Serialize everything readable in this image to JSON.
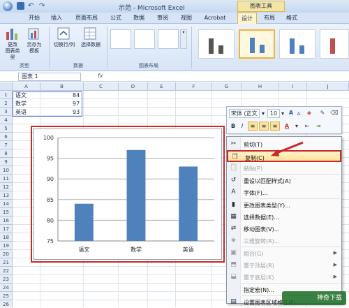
{
  "window": {
    "title": "示范 - Microsoft Excel",
    "context_tab_title": "图表工具"
  },
  "tabs": [
    {
      "label": "开始"
    },
    {
      "label": "插入"
    },
    {
      "label": "页面布局"
    },
    {
      "label": "公式"
    },
    {
      "label": "数据"
    },
    {
      "label": "审阅"
    },
    {
      "label": "视图"
    },
    {
      "label": "Acrobat"
    },
    {
      "label": "设计"
    },
    {
      "label": "布局"
    },
    {
      "label": "格式"
    }
  ],
  "ribbon": {
    "change_type_label": "更改\n图表类型",
    "save_template_label": "另存为\n模板",
    "switch_row_col_label": "切换行/列",
    "select_data_label": "选择数据",
    "group_type": "类型",
    "group_data": "数据",
    "group_layout": "图表布局"
  },
  "formula_bar": {
    "name_box": "图表 1",
    "fx": "fx"
  },
  "sheet": {
    "columns": [
      "A",
      "B",
      "C",
      "D",
      "E",
      "F",
      "G",
      "H",
      "I",
      "J"
    ],
    "rows": [
      "1",
      "2",
      "3",
      "4",
      "5",
      "6",
      "7",
      "8",
      "9",
      "10",
      "11",
      "12",
      "13",
      "14",
      "15",
      "16",
      "17",
      "18",
      "19",
      "20",
      "21",
      "22",
      "23",
      "24",
      "25",
      "26",
      "27"
    ],
    "cells": [
      {
        "a": "语文",
        "b": "84"
      },
      {
        "a": "数学",
        "b": "97"
      },
      {
        "a": "英语",
        "b": "93"
      }
    ]
  },
  "chart_data": {
    "type": "bar",
    "categories": [
      "语文",
      "数学",
      "英语"
    ],
    "values": [
      84,
      97,
      93
    ],
    "ylim": [
      75,
      100
    ],
    "yticks": [
      "75",
      "80",
      "85",
      "90",
      "95",
      "100"
    ],
    "bar_color": "#4f81bd",
    "grid": true
  },
  "mini_toolbar": {
    "font": "宋体 (正文",
    "size": "10",
    "bold": "B",
    "italic": "I"
  },
  "context_menu": [
    {
      "label": "剪切(T)",
      "icon": "scissors-icon",
      "glyph": "✂",
      "disabled": false
    },
    {
      "label": "复制(C)",
      "icon": "copy-icon",
      "glyph": "❐",
      "disabled": false,
      "highlight": true
    },
    {
      "label": "粘贴(P)",
      "icon": "paste-icon",
      "glyph": "📋",
      "disabled": true
    },
    {
      "label": "重设以匹配样式(A)",
      "icon": "reset-style-icon",
      "glyph": "↺",
      "disabled": false
    },
    {
      "label": "字体(F)...",
      "icon": "font-icon",
      "glyph": "A",
      "disabled": false
    },
    {
      "label": "更改图表类型(Y)...",
      "icon": "chart-type-icon",
      "glyph": "▮",
      "disabled": false
    },
    {
      "label": "选择数据(E)...",
      "icon": "select-data-icon",
      "glyph": "▦",
      "disabled": false
    },
    {
      "label": "移动图表(V)...",
      "icon": "move-chart-icon",
      "glyph": "⇄",
      "disabled": false
    },
    {
      "label": "三维旋转(R)...",
      "icon": "rotate-3d-icon",
      "glyph": "◈",
      "disabled": true
    },
    {
      "label": "组合(G)",
      "icon": "group-icon",
      "glyph": "▣",
      "disabled": true,
      "submenu": true
    },
    {
      "label": "置于顶层(R)",
      "icon": "bring-front-icon",
      "glyph": "⬒",
      "disabled": true,
      "submenu": true
    },
    {
      "label": "置于底层(K)",
      "icon": "send-back-icon",
      "glyph": "⬓",
      "disabled": true,
      "submenu": true
    },
    {
      "label": "指定宏(N)...",
      "icon": "macro-icon",
      "glyph": "",
      "disabled": false
    },
    {
      "label": "设置图表区域格式(F)...",
      "icon": "format-area-icon",
      "glyph": "▤",
      "disabled": false
    }
  ],
  "watermark": "神奇下载"
}
